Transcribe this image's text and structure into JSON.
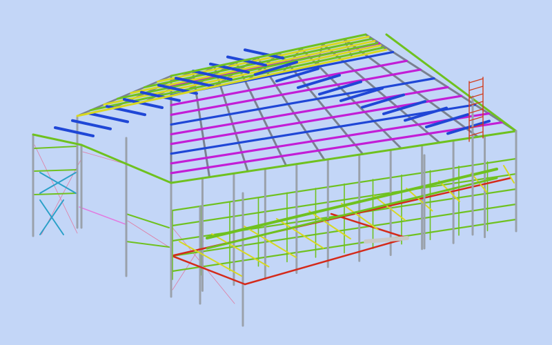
{
  "viewport": {
    "background": "#c3d6f7"
  },
  "model": {
    "kind": "steel-frame-building",
    "view": "isometric-3d",
    "member_colors": {
      "columns": "#9aa1ab",
      "rafters": "#7a8190",
      "eave_purlins": "#1f47d6",
      "ridge_purlins": "#d8d820",
      "roof_purlins": "#c21ed6",
      "roof_edge": "#6fc11f",
      "wall_girts": "#6fc11f",
      "bracing": "#2aa0c8",
      "platform_beams": "#d42a1a",
      "cable_bracing": "#e07aa0",
      "ladder": "#d23c1c"
    }
  }
}
